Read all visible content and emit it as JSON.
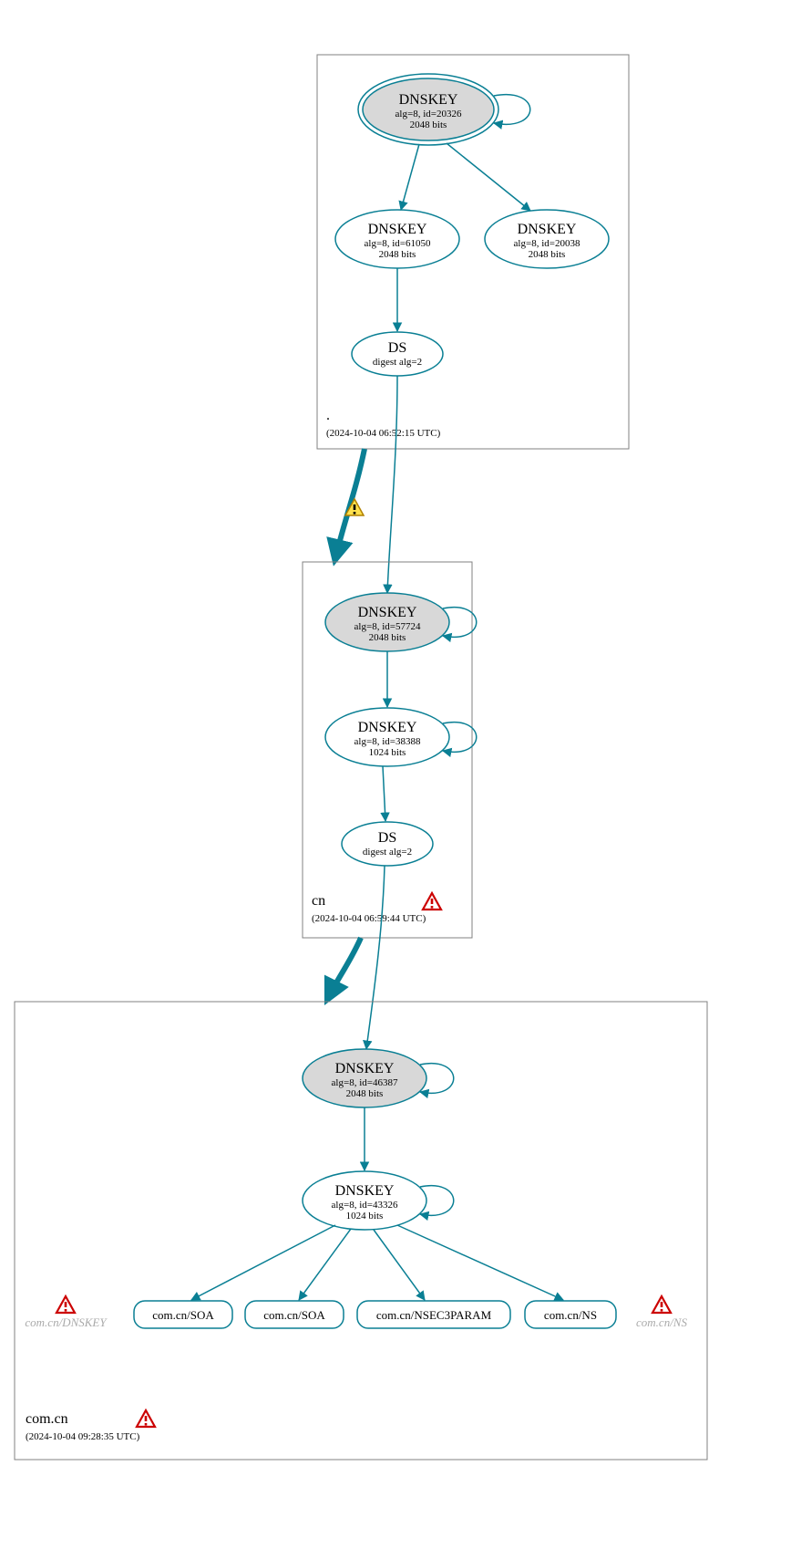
{
  "colors": {
    "stroke": "#0a7f94",
    "ksk_fill": "#d8d8d8",
    "box": "#808080",
    "text": "#000000"
  },
  "zones": {
    "root": {
      "label": ".",
      "timestamp": "(2024-10-04 06:52:15 UTC)",
      "nodes": {
        "ksk": {
          "title": "DNSKEY",
          "line1": "alg=8, id=20326",
          "line2": "2048 bits"
        },
        "zsk1": {
          "title": "DNSKEY",
          "line1": "alg=8, id=61050",
          "line2": "2048 bits"
        },
        "zsk2": {
          "title": "DNSKEY",
          "line1": "alg=8, id=20038",
          "line2": "2048 bits"
        },
        "ds": {
          "title": "DS",
          "line1": "digest alg=2"
        }
      }
    },
    "cn": {
      "label": "cn",
      "timestamp": "(2024-10-04 06:59:44 UTC)",
      "nodes": {
        "ksk": {
          "title": "DNSKEY",
          "line1": "alg=8, id=57724",
          "line2": "2048 bits"
        },
        "zsk": {
          "title": "DNSKEY",
          "line1": "alg=8, id=38388",
          "line2": "1024 bits"
        },
        "ds": {
          "title": "DS",
          "line1": "digest alg=2"
        }
      }
    },
    "comcn": {
      "label": "com.cn",
      "timestamp": "(2024-10-04 09:28:35 UTC)",
      "nodes": {
        "ksk": {
          "title": "DNSKEY",
          "line1": "alg=8, id=46387",
          "line2": "2048 bits"
        },
        "zsk": {
          "title": "DNSKEY",
          "line1": "alg=8, id=43326",
          "line2": "1024 bits"
        },
        "rr1": {
          "title": "com.cn/SOA"
        },
        "rr2": {
          "title": "com.cn/SOA"
        },
        "rr3": {
          "title": "com.cn/NSEC3PARAM"
        },
        "rr4": {
          "title": "com.cn/NS"
        }
      },
      "ghosts": {
        "left": "com.cn/DNSKEY",
        "right": "com.cn/NS"
      }
    }
  }
}
